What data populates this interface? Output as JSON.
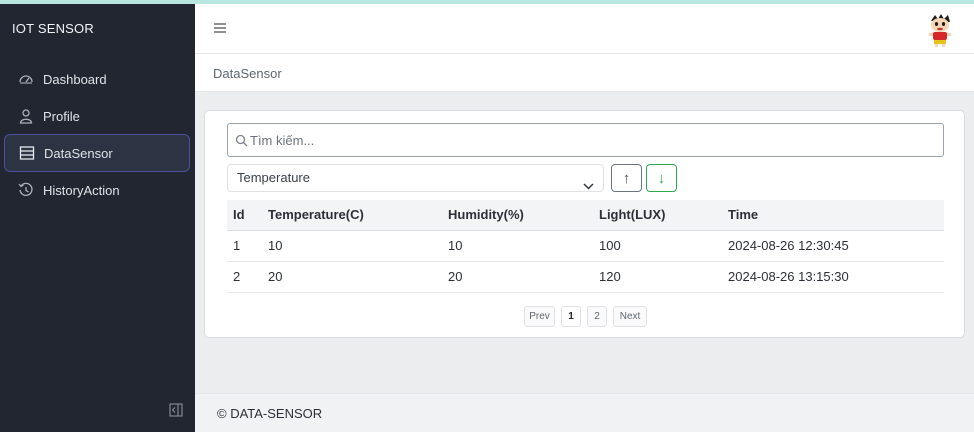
{
  "app": {
    "brand": "IOT SENSOR"
  },
  "sidebar": {
    "items": [
      {
        "label": "Dashboard",
        "icon": "speedometer-icon",
        "active": false
      },
      {
        "label": "Profile",
        "icon": "user-icon",
        "active": false
      },
      {
        "label": "DataSensor",
        "icon": "table-icon",
        "active": true
      },
      {
        "label": "HistoryAction",
        "icon": "history-icon",
        "active": false
      }
    ]
  },
  "header": {
    "breadcrumb": "DataSensor"
  },
  "search": {
    "placeholder": "Tìm kiếm..."
  },
  "filter": {
    "selected": "Temperature"
  },
  "sort": {
    "asc": "↑",
    "desc": "↓"
  },
  "table": {
    "columns": [
      "Id",
      "Temperature(C)",
      "Humidity(%)",
      "Light(LUX)",
      "Time"
    ],
    "rows": [
      [
        "1",
        "10",
        "10",
        "100",
        "2024-08-26 12:30:45"
      ],
      [
        "2",
        "20",
        "20",
        "120",
        "2024-08-26 13:15:30"
      ]
    ]
  },
  "pagination": {
    "prev": "Prev",
    "pages": [
      "1",
      "2"
    ],
    "next": "Next",
    "current": "1"
  },
  "footer": {
    "text": "© DATA-SENSOR"
  },
  "colors": {
    "sidebar_bg": "#212631",
    "active_border": "#4b4f9e",
    "success": "#2ea84f"
  }
}
